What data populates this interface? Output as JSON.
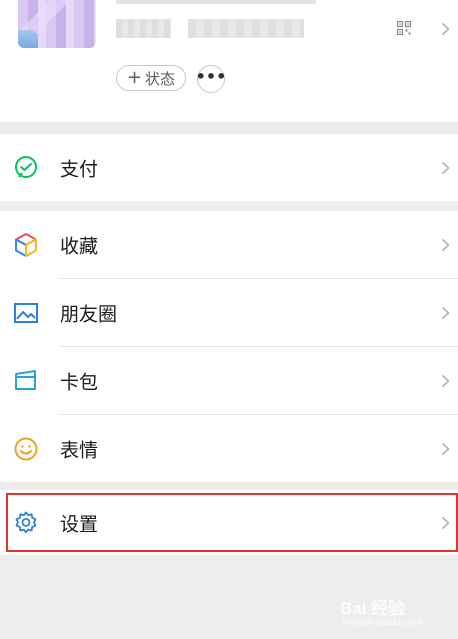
{
  "profile": {
    "status_label": "状态",
    "status_plus": "+",
    "more_label": "•••"
  },
  "menu": {
    "pay": {
      "label": "支付",
      "icon": "wechat-pay-icon"
    },
    "favorites": {
      "label": "收藏",
      "icon": "cube-icon"
    },
    "moments": {
      "label": "朋友圈",
      "icon": "picture-icon"
    },
    "cards": {
      "label": "卡包",
      "icon": "wallet-card-icon"
    },
    "stickers": {
      "label": "表情",
      "icon": "smiley-icon"
    },
    "settings": {
      "label": "设置",
      "icon": "gear-icon"
    }
  },
  "colors": {
    "pay_green": "#07c160",
    "settings_blue": "#2e7fd8",
    "sticker_orange": "#f0a020",
    "highlight_red": "#e0352b"
  },
  "watermark": {
    "text": "Bai 经验",
    "sub": "jingyan.baidu.com"
  }
}
